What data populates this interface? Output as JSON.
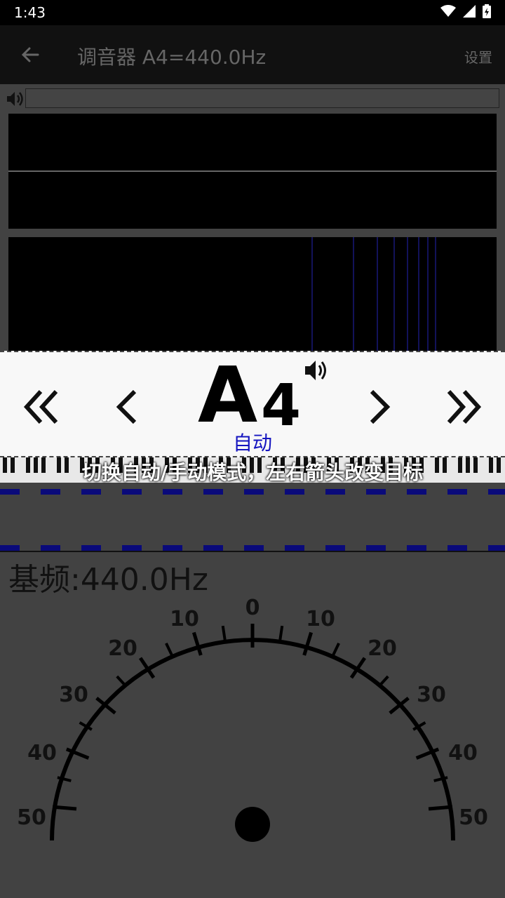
{
  "status_bar": {
    "time": "1:43"
  },
  "app_bar": {
    "title": "调音器 A4=440.0Hz",
    "settings_label": "设置"
  },
  "tuner": {
    "note_letter": "A",
    "note_octave": "4",
    "mode_label": "自动",
    "hint_text": "切换自动/手动模式，左右箭头改变目标",
    "base_frequency_text": "基频:440.0Hz"
  },
  "gauge": {
    "center_label": "0",
    "left_labels": [
      "10",
      "20",
      "30",
      "40",
      "50"
    ],
    "right_labels": [
      "10",
      "20",
      "30",
      "40",
      "50"
    ],
    "needle_value": 0
  },
  "colors": {
    "background": "#424242",
    "note_panel": "#f8f8f8",
    "accent_blue": "#1515c0",
    "dash_blue": "#0a0a7a"
  },
  "icons": [
    "back-arrow-icon",
    "volume-icon",
    "wifi-icon",
    "signal-icon",
    "battery-icon",
    "speaker-icon"
  ]
}
